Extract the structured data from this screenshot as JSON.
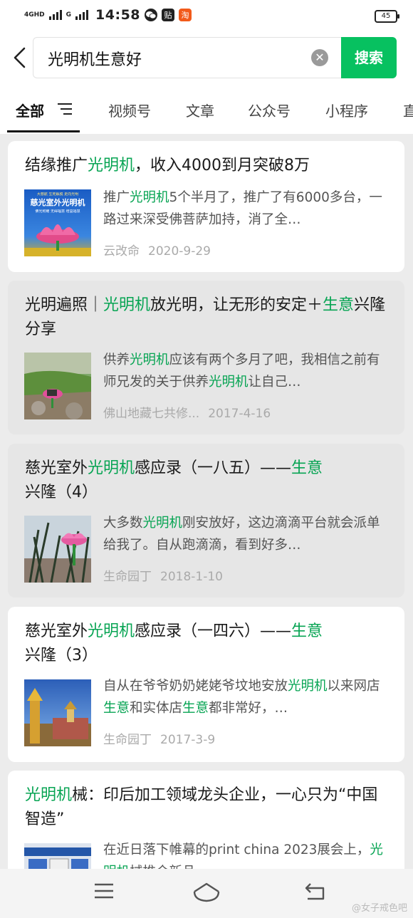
{
  "status_bar": {
    "network": "4GHD",
    "network2": "G",
    "time": "14:58",
    "icons": [
      "wechat-icon",
      "tieba-icon",
      "taobao-icon"
    ],
    "icon_labels": [
      "",
      "贴",
      "淘"
    ],
    "battery": "45"
  },
  "search": {
    "query": "光明机生意好",
    "button_label": "搜索"
  },
  "tabs": [
    {
      "label": "全部",
      "active": true
    },
    {
      "label": "视频号"
    },
    {
      "label": "文章"
    },
    {
      "label": "公众号"
    },
    {
      "label": "小程序"
    },
    {
      "label": "直"
    }
  ],
  "results": [
    {
      "title": [
        "结缘推广",
        {
          "hl": "光明机"
        },
        "，收入4000到月突破8万"
      ],
      "snippet": [
        "推广",
        {
          "hl": "光明机"
        },
        "5个半月了，推广了有6000多台，一路过来深受佛菩萨加持，消了全…"
      ],
      "thumb": "pink-lotus-speaker-ad",
      "thumb_text": {
        "top": "大慈航 生死解脱 走向光明",
        "main": "慈光室外光明机",
        "sub": "佛光照耀 无碍福慧 增益福慧"
      },
      "source": "云改命",
      "date": "2020-9-29"
    },
    {
      "title": [
        "光明遍照｜",
        {
          "hl": "光明机"
        },
        "放光明，让无形的安定＋",
        {
          "hl": "生意"
        },
        "兴隆分享"
      ],
      "snippet": [
        "供养",
        {
          "hl": "光明机"
        },
        "应该有两个多月了吧，我相信之前有师兄发的关于供养",
        {
          "hl": "光明机"
        },
        "让自己…"
      ],
      "thumb": "lotus-on-rocks-photo",
      "source": "佛山地藏七共修...",
      "date": "2017-4-16"
    },
    {
      "title": [
        "慈光室外",
        {
          "hl": "光明机"
        },
        "感应录（一八五）——",
        {
          "hl": "生意"
        },
        "兴隆（4）"
      ],
      "snippet": [
        "大多数",
        {
          "hl": "光明机"
        },
        "刚安放好，这边滴滴平台就会派单给我了。自从跑滴滴，看到好多…"
      ],
      "thumb": "lotus-in-plant-pot-photo",
      "source": "生命园丁",
      "date": "2018-1-10"
    },
    {
      "title": [
        "慈光室外",
        {
          "hl": "光明机"
        },
        "感应录（一四六）——",
        {
          "hl": "生意"
        },
        "兴隆（3）"
      ],
      "snippet": [
        "自从在爷爷奶奶姥姥爷坟地安放",
        {
          "hl": "光明机"
        },
        "以来网店",
        {
          "hl": "生意"
        },
        "和实体店",
        {
          "hl": "生意"
        },
        "都非常好，…"
      ],
      "thumb": "temple-stupa-photo",
      "source": "生命园丁",
      "date": "2017-3-9"
    },
    {
      "title": [
        {
          "hl": "光明机"
        },
        "械：印后加工领域龙头企业，一心只为“中国智造”"
      ],
      "snippet": [
        "在近日落下帷幕的print china 2023展会上，",
        {
          "hl": "光明机"
        },
        "械推介新品"
      ],
      "thumb": "trade-show-booth-photo",
      "source": "",
      "date": ""
    }
  ],
  "nav_bar": {
    "icons": [
      "menu-icon",
      "home-icon",
      "back-icon"
    ],
    "watermark": "@女子戒色吧"
  },
  "colors": {
    "accent": "#07c160",
    "highlight": "#07a453",
    "background": "#ececec"
  }
}
